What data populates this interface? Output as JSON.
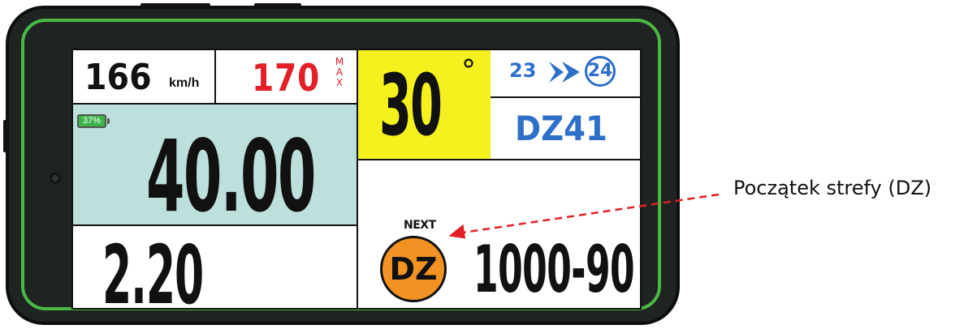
{
  "speed": {
    "value": "166",
    "unit": "km/h"
  },
  "max_speed": {
    "value": "170",
    "max_letters": [
      "M",
      "A",
      "X"
    ]
  },
  "battery": {
    "percent": "37%",
    "level": 0.37
  },
  "main_distance": "40.00",
  "secondary_distance": "2.20",
  "heading": {
    "value": "30",
    "degree_symbol": "°"
  },
  "waypoints": {
    "current": "23",
    "next": "24"
  },
  "zone_code": "DZ41",
  "next_zone": {
    "label": "NEXT",
    "badge": "DZ",
    "value": "1000-90"
  },
  "annotation": {
    "text": "Początek strefy (DZ)"
  },
  "colors": {
    "speed_max": "#e32028",
    "waypoint_blue": "#2e6fc9",
    "heading_bg": "#f4f11f",
    "distance_bg": "#bde0dd",
    "zone_badge": "#f29222",
    "frame_green": "#49b844",
    "arrow_red": "#e32028"
  }
}
